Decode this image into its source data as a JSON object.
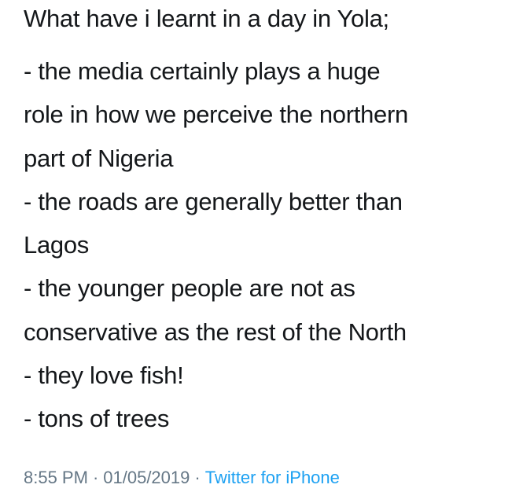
{
  "tweet": {
    "heading": "What have i learnt in a day in Yola;",
    "lines": [
      "- the media certainly plays a huge",
      "role in how we perceive the northern",
      "part of Nigeria",
      "- the roads are generally better than",
      "Lagos",
      "- the younger people are not as",
      "conservative as the rest of the North",
      "- they love fish!",
      "- tons of trees"
    ],
    "time": "8:55 PM",
    "separator": "·",
    "date": "01/05/2019",
    "source": "Twitter for iPhone"
  },
  "colors": {
    "text": "#14171a",
    "meta": "#657786",
    "link": "#1da1f2"
  }
}
